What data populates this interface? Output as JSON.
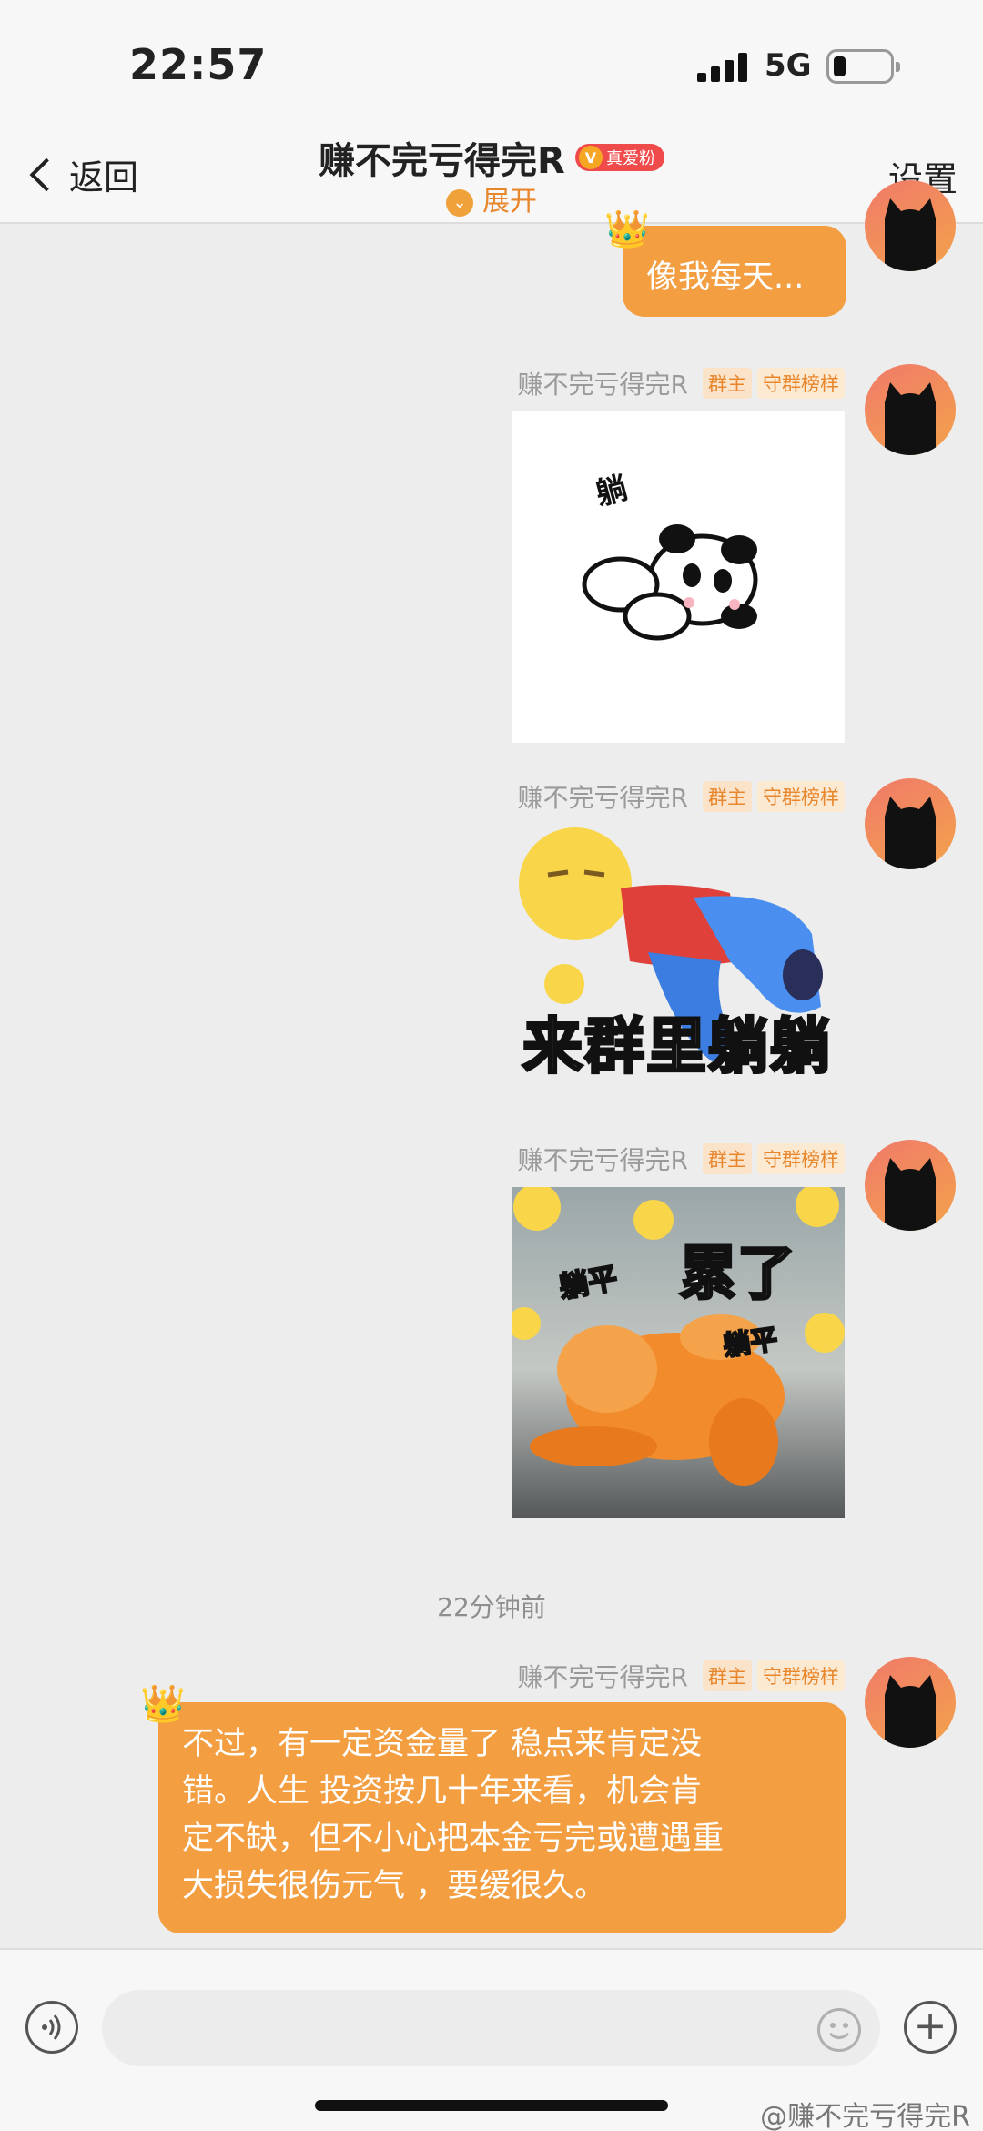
{
  "status_bar": {
    "time": "22:57",
    "network": "5G"
  },
  "header": {
    "back_label": "返回",
    "title": "赚不完亏得完R",
    "fan_badge": "真爱粉",
    "expand_label": "展开",
    "settings_label": "设置"
  },
  "messages": [
    {
      "type": "text",
      "text": "像我每天..."
    },
    {
      "type": "image",
      "sender": "赚不完亏得完R",
      "tags": [
        "群主",
        "守群榜样"
      ],
      "sticker_text": "躺"
    },
    {
      "type": "image",
      "sender": "赚不完亏得完R",
      "tags": [
        "群主",
        "守群榜样"
      ],
      "sticker_text": "来群里躺躺"
    },
    {
      "type": "image",
      "sender": "赚不完亏得完R",
      "tags": [
        "群主",
        "守群榜样"
      ],
      "sticker_text": [
        "躺平",
        "累了",
        "躺平"
      ]
    },
    {
      "type": "text",
      "sender": "赚不完亏得完R",
      "tags": [
        "群主",
        "守群榜样"
      ],
      "lines": [
        "不过，有一定资金量了 稳点来肯定没",
        "错。人生 投资按几十年来看，机会肯",
        "定不缺，但不小心把本金亏完或遭遇重",
        "大损失很伤元气 ，要缓很久。"
      ]
    }
  ],
  "timestamp": "22分钟前",
  "input": {
    "placeholder": ""
  },
  "watermark": "@赚不完亏得完R",
  "colors": {
    "bubble": "#f29e41",
    "accent": "#e8862b",
    "background": "#ededed"
  }
}
